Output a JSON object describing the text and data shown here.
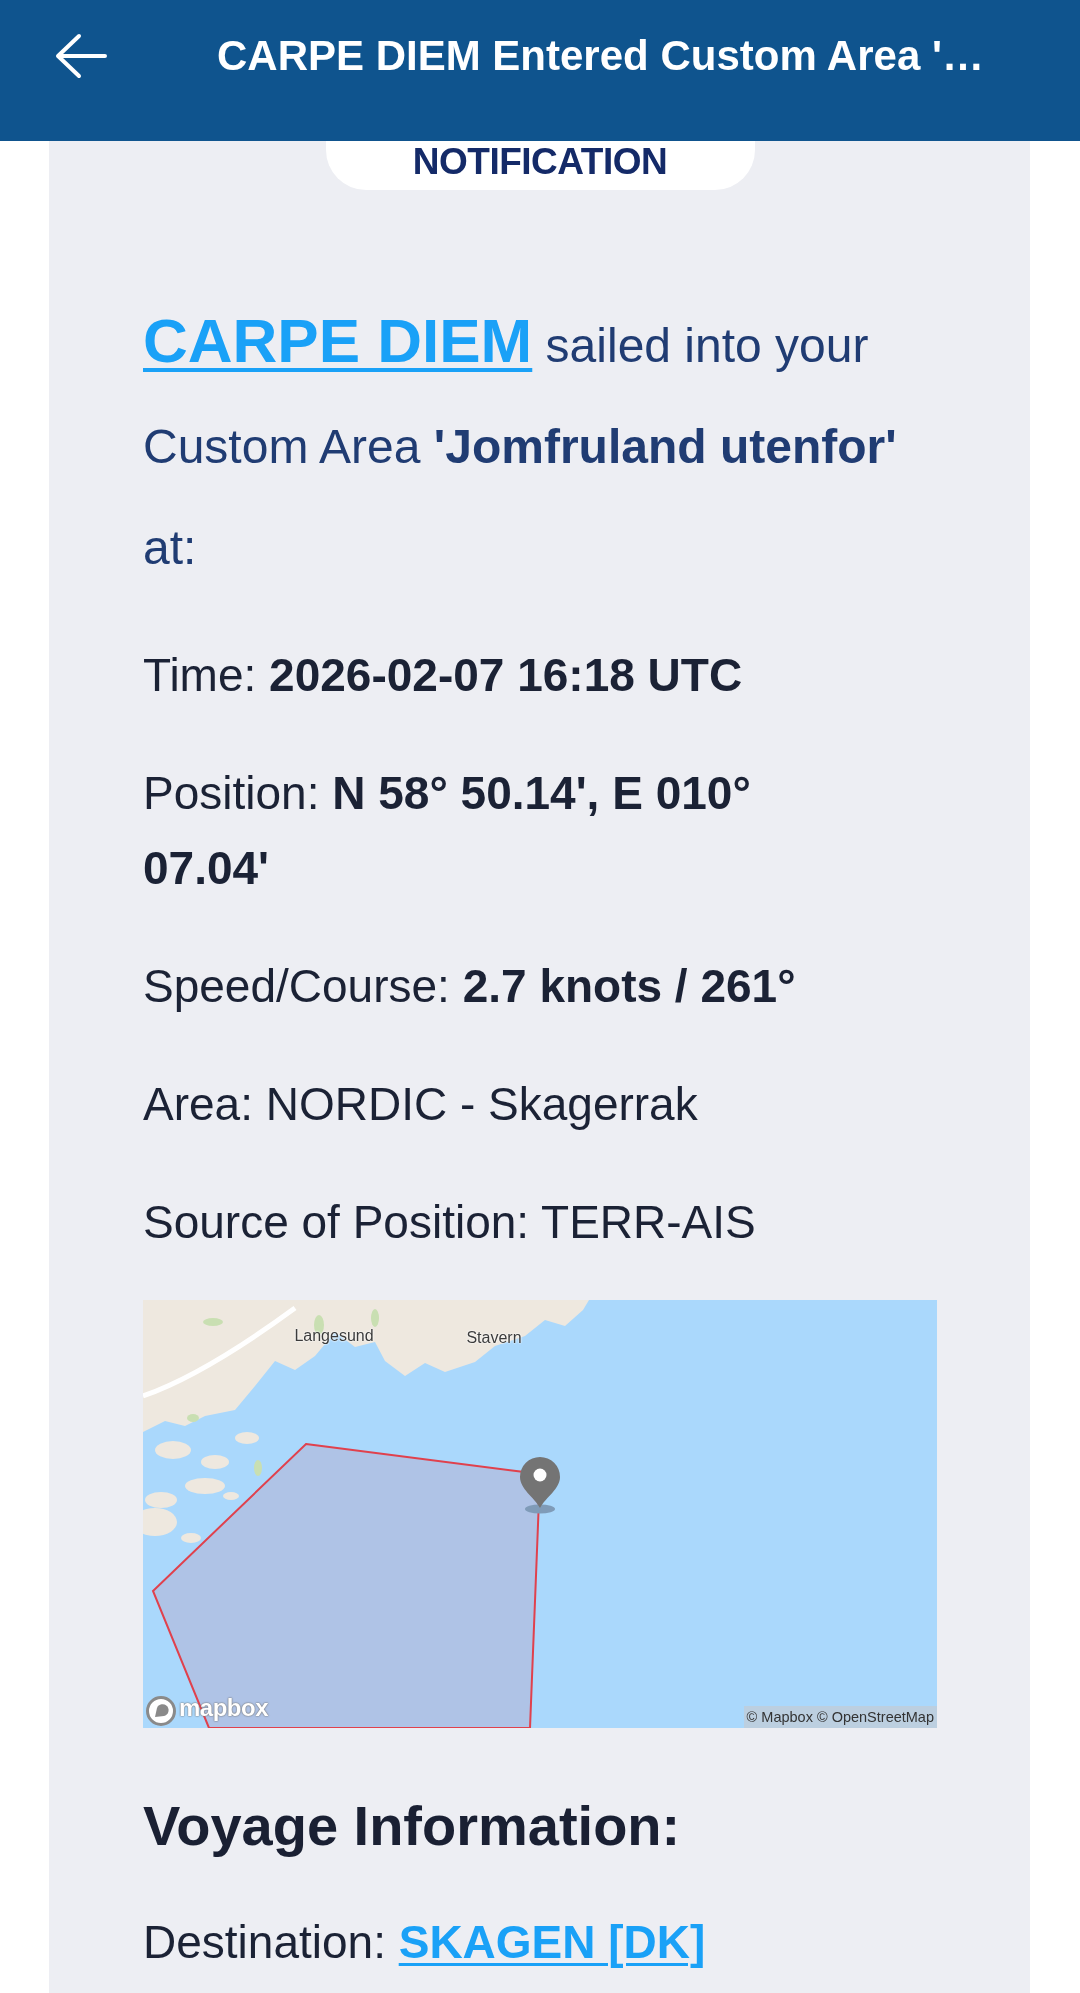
{
  "app_bar": {
    "title": "CARPE DIEM Entered Custom Area '…"
  },
  "notification": {
    "label": "NOTIFICATION",
    "vessel": "CARPE DIEM",
    "message": "sailed into your Custom Area **'Jomfruland utenfor'** at:"
  },
  "details": [
    {
      "label": "Time:",
      "value": "2026-02-07 16:18 UTC",
      "kind": "bold"
    },
    {
      "label": "Position:",
      "value": "N 58° 50.14', E 010° 07.04'",
      "kind": "bold"
    },
    {
      "label": "Speed/Course:",
      "value": "2.7 knots / 261°",
      "kind": "bold"
    },
    {
      "label": "Area:",
      "value": "NORDIC - Skagerrak",
      "kind": "plain"
    },
    {
      "label": "Source of Position:",
      "value": "TERR-AIS",
      "kind": "plain"
    }
  ],
  "map": {
    "place_labels": [
      "Langesund",
      "Stavern"
    ],
    "logo": "mapbox",
    "attribution": "© Mapbox © OpenStreetMap"
  },
  "voyage": {
    "heading": "Voyage Information:",
    "details": [
      {
        "label": "Destination:",
        "value": "SKAGEN [DK]",
        "kind": "link"
      }
    ]
  }
}
